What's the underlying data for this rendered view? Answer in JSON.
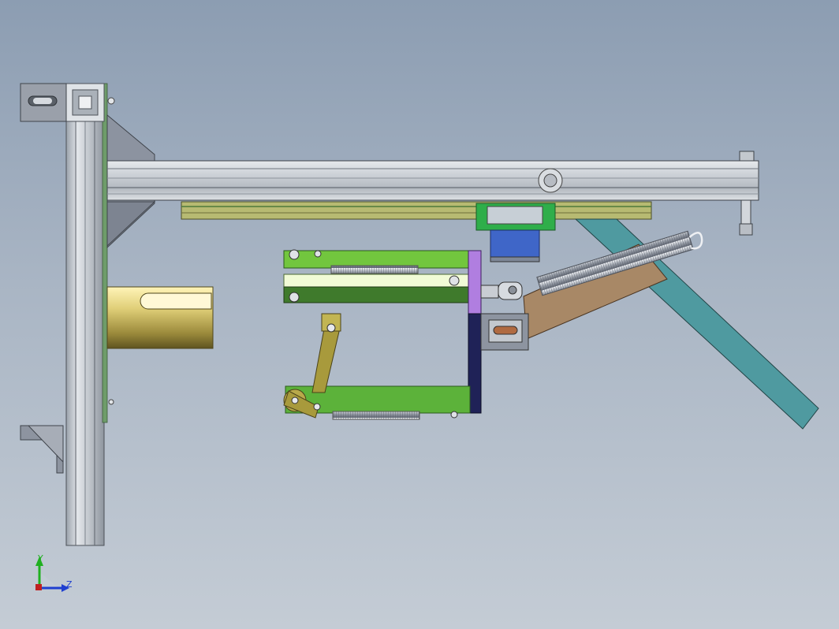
{
  "viewport": {
    "background_top": "#8c9db2",
    "background_bottom": "#c4ccd5"
  },
  "triad": {
    "y_label": "Y",
    "z_label": "Z",
    "y_color": "#20b020",
    "z_color": "#1f3fd0",
    "origin_color": "#c02020"
  },
  "colors": {
    "frame_aluminum": "#c9ced4",
    "bracket_steel": "#8f96a3",
    "arm_green": "#6cc23c",
    "arm_green_dark": "#3a7a2a",
    "linkage_olive": "#a89a3c",
    "plate_navy": "#1f2257",
    "plate_violet": "#b07ee0",
    "block_blue": "#3a64c8",
    "bar_teal": "#4f9aa0",
    "bar_tan": "#a88866",
    "sleeve_gold": "#c9ba5e",
    "spring_silver": "#b7bcc6"
  }
}
